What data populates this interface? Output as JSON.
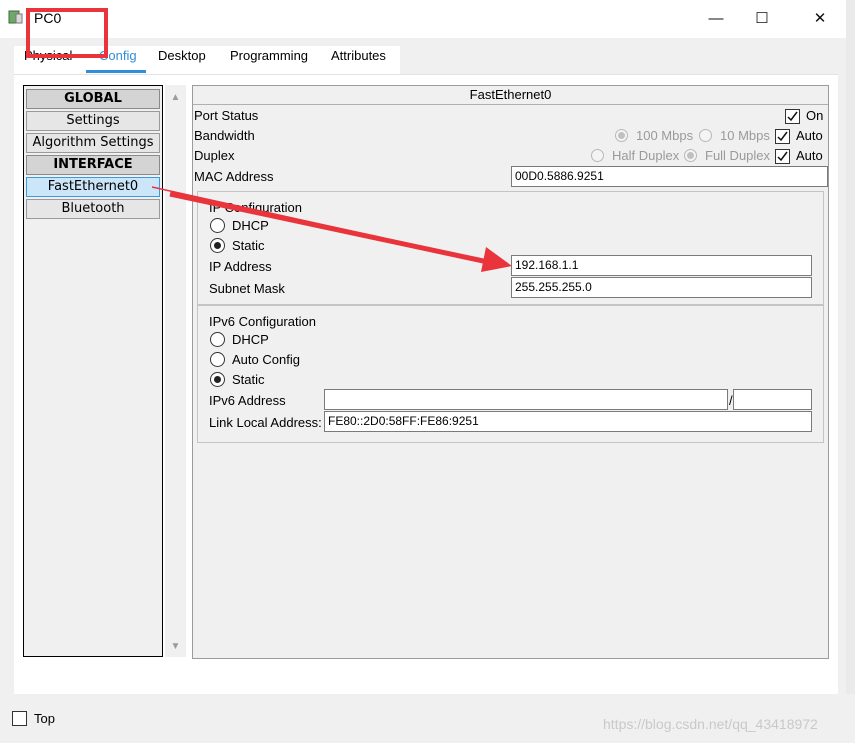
{
  "window": {
    "title": "PC0",
    "minimize_glyph": "—",
    "maximize_glyph": "☐",
    "close_glyph": "✕"
  },
  "tabs": [
    {
      "label": "Physical"
    },
    {
      "label": "Config",
      "active": true
    },
    {
      "label": "Desktop"
    },
    {
      "label": "Programming"
    },
    {
      "label": "Attributes"
    }
  ],
  "sidebar": {
    "items": [
      {
        "label": "GLOBAL",
        "type": "header"
      },
      {
        "label": "Settings"
      },
      {
        "label": "Algorithm Settings"
      },
      {
        "label": "INTERFACE",
        "type": "header"
      },
      {
        "label": "FastEthernet0",
        "selected": true
      },
      {
        "label": "Bluetooth"
      }
    ]
  },
  "panel": {
    "title": "FastEthernet0",
    "port_status_label": "Port Status",
    "port_on_label": "On",
    "port_on": true,
    "bandwidth_label": "Bandwidth",
    "bw_100": "100 Mbps",
    "bw_10": "10 Mbps",
    "bw_auto_label": "Auto",
    "bw_auto": true,
    "duplex_label": "Duplex",
    "half_duplex": "Half Duplex",
    "full_duplex": "Full Duplex",
    "duplex_auto_label": "Auto",
    "duplex_auto": true,
    "mac_label": "MAC Address",
    "mac_value": "00D0.5886.9251"
  },
  "ip_config": {
    "title": "IP Configuration",
    "dhcp_label": "DHCP",
    "static_label": "Static",
    "selected": "Static",
    "ip_label": "IP Address",
    "ip_value": "192.168.1.1",
    "mask_label": "Subnet Mask",
    "mask_value": "255.255.255.0"
  },
  "ipv6_config": {
    "title": "IPv6 Configuration",
    "dhcp_label": "DHCP",
    "auto_label": "Auto Config",
    "static_label": "Static",
    "selected": "Static",
    "addr_label": "IPv6 Address",
    "addr_value": "",
    "slash": "/",
    "prefix_value": "",
    "link_local_label": "Link Local Address:",
    "link_local_value": "FE80::2D0:58FF:FE86:9251"
  },
  "footer": {
    "top_label": "Top",
    "top_checked": false,
    "watermark": "https://blog.csdn.net/qq_43418972"
  },
  "annotation": {
    "color": "#e8343a"
  }
}
